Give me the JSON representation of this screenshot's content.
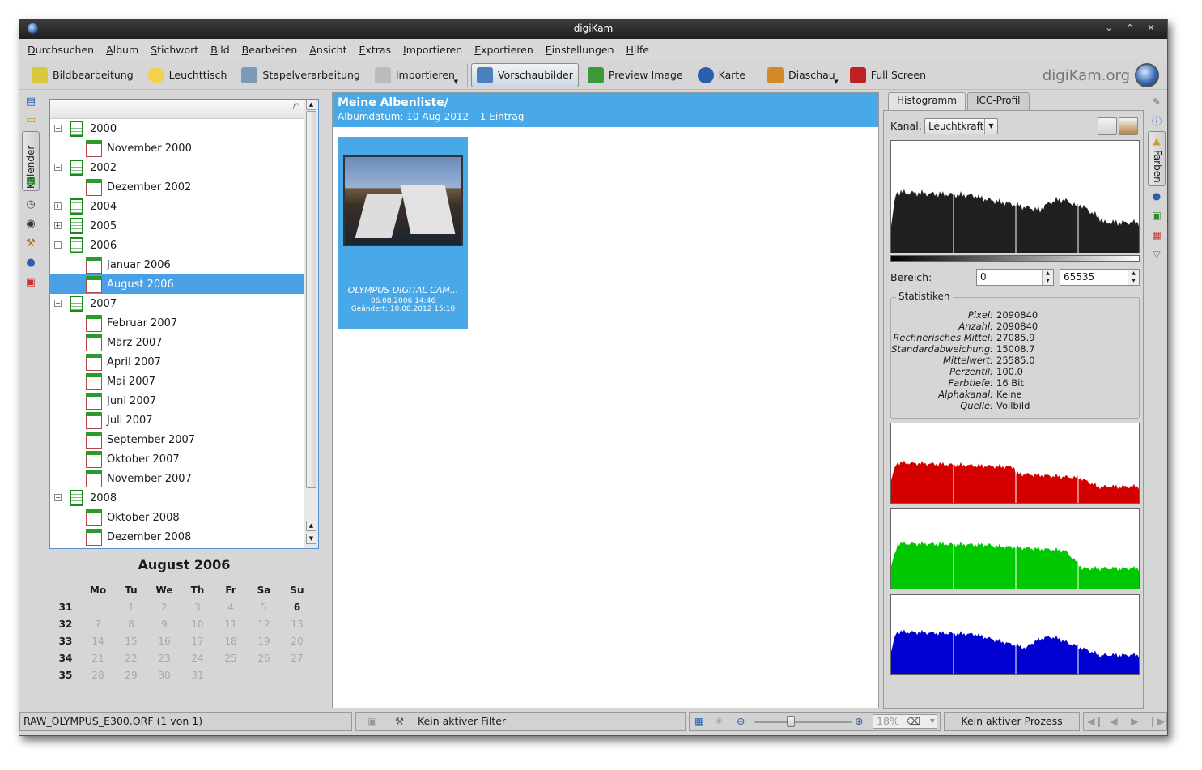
{
  "window": {
    "title": "digiKam"
  },
  "menubar": [
    "Durchsuchen",
    "Album",
    "Stichwort",
    "Bild",
    "Bearbeiten",
    "Ansicht",
    "Extras",
    "Importieren",
    "Exportieren",
    "Einstellungen",
    "Hilfe"
  ],
  "toolbar": {
    "items": [
      {
        "label": "Bildbearbeitung",
        "icon": "image-edit-icon"
      },
      {
        "label": "Leuchttisch",
        "icon": "lightbulb-icon"
      },
      {
        "label": "Stapelverarbeitung",
        "icon": "batch-icon"
      },
      {
        "label": "Importieren",
        "icon": "camera-icon"
      },
      {
        "label": "Vorschaubilder",
        "icon": "thumbnails-icon"
      },
      {
        "label": "Preview Image",
        "icon": "preview-icon"
      },
      {
        "label": "Karte",
        "icon": "globe-icon"
      },
      {
        "label": "Diaschau",
        "icon": "slideshow-icon"
      },
      {
        "label": "Full Screen",
        "icon": "fullscreen-icon"
      }
    ],
    "brand": "digiKam.org"
  },
  "left_tab": "Kalender",
  "tree": [
    {
      "label": "2000",
      "level": 0,
      "type": "year"
    },
    {
      "label": "November 2000",
      "level": 1,
      "type": "month"
    },
    {
      "label": "2002",
      "level": 0,
      "type": "year"
    },
    {
      "label": "Dezember 2002",
      "level": 1,
      "type": "month"
    },
    {
      "label": "2004",
      "level": 0,
      "type": "year",
      "collapsed": true
    },
    {
      "label": "2005",
      "level": 0,
      "type": "year",
      "collapsed": true
    },
    {
      "label": "2006",
      "level": 0,
      "type": "year"
    },
    {
      "label": "Januar 2006",
      "level": 1,
      "type": "month"
    },
    {
      "label": "August 2006",
      "level": 1,
      "type": "month",
      "selected": true
    },
    {
      "label": "2007",
      "level": 0,
      "type": "year"
    },
    {
      "label": "Februar 2007",
      "level": 1,
      "type": "month"
    },
    {
      "label": "März 2007",
      "level": 1,
      "type": "month"
    },
    {
      "label": "April 2007",
      "level": 1,
      "type": "month"
    },
    {
      "label": "Mai 2007",
      "level": 1,
      "type": "month"
    },
    {
      "label": "Juni 2007",
      "level": 1,
      "type": "month"
    },
    {
      "label": "Juli 2007",
      "level": 1,
      "type": "month"
    },
    {
      "label": "September 2007",
      "level": 1,
      "type": "month"
    },
    {
      "label": "Oktober 2007",
      "level": 1,
      "type": "month"
    },
    {
      "label": "November 2007",
      "level": 1,
      "type": "month"
    },
    {
      "label": "2008",
      "level": 0,
      "type": "year"
    },
    {
      "label": "Oktober 2008",
      "level": 1,
      "type": "month"
    },
    {
      "label": "Dezember 2008",
      "level": 1,
      "type": "month"
    }
  ],
  "calendar": {
    "title": "August 2006",
    "days": [
      "Mo",
      "Tu",
      "We",
      "Th",
      "Fr",
      "Sa",
      "Su"
    ],
    "weeks": [
      {
        "wk": "31",
        "d": [
          "",
          "1",
          "2",
          "3",
          "4",
          "5",
          "6"
        ]
      },
      {
        "wk": "32",
        "d": [
          "7",
          "8",
          "9",
          "10",
          "11",
          "12",
          "13"
        ]
      },
      {
        "wk": "33",
        "d": [
          "14",
          "15",
          "16",
          "17",
          "18",
          "19",
          "20"
        ]
      },
      {
        "wk": "34",
        "d": [
          "21",
          "22",
          "23",
          "24",
          "25",
          "26",
          "27"
        ]
      },
      {
        "wk": "35",
        "d": [
          "28",
          "29",
          "30",
          "31",
          "",
          "",
          ""
        ]
      }
    ],
    "bold_days": [
      "6"
    ]
  },
  "album": {
    "title": "Meine Albenliste/",
    "subtitle": "Albumdatum: 10 Aug 2012 – 1 Eintrag",
    "item": {
      "caption": "OLYMPUS DIGITAL CAM...",
      "date": "06.08.2006 14:46",
      "modified": "Geändert: 10.08.2012 15:10"
    }
  },
  "right": {
    "tabs": [
      "Histogramm",
      "ICC-Profil"
    ],
    "channel_label": "Kanal:",
    "channel_value": "Leuchtkraft",
    "range_label": "Bereich:",
    "range_min": "0",
    "range_max": "65535",
    "stats_title": "Statistiken",
    "stats": [
      {
        "k": "Pixel:",
        "v": "2090840"
      },
      {
        "k": "Anzahl:",
        "v": "2090840"
      },
      {
        "k": "Rechnerisches Mittel:",
        "v": "27085.9"
      },
      {
        "k": "Standardabweichung:",
        "v": "15008.7"
      },
      {
        "k": "Mittelwert:",
        "v": "25585.0"
      },
      {
        "k": "Perzentil:",
        "v": "100.0"
      },
      {
        "k": "Farbtiefe:",
        "v": "16 Bit"
      },
      {
        "k": "Alphakanal:",
        "v": "Keine"
      },
      {
        "k": "Quelle:",
        "v": "Vollbild"
      }
    ],
    "side_tab": "Farben",
    "hist_colors": {
      "lum": "#202020",
      "red": "#d40000",
      "green": "#00c800",
      "blue": "#0000d0"
    }
  },
  "status": {
    "file": "RAW_OLYMPUS_E300.ORF (1 von 1)",
    "filter": "Kein aktiver Filter",
    "zoom": "18%",
    "process": "Kein aktiver Prozess"
  }
}
